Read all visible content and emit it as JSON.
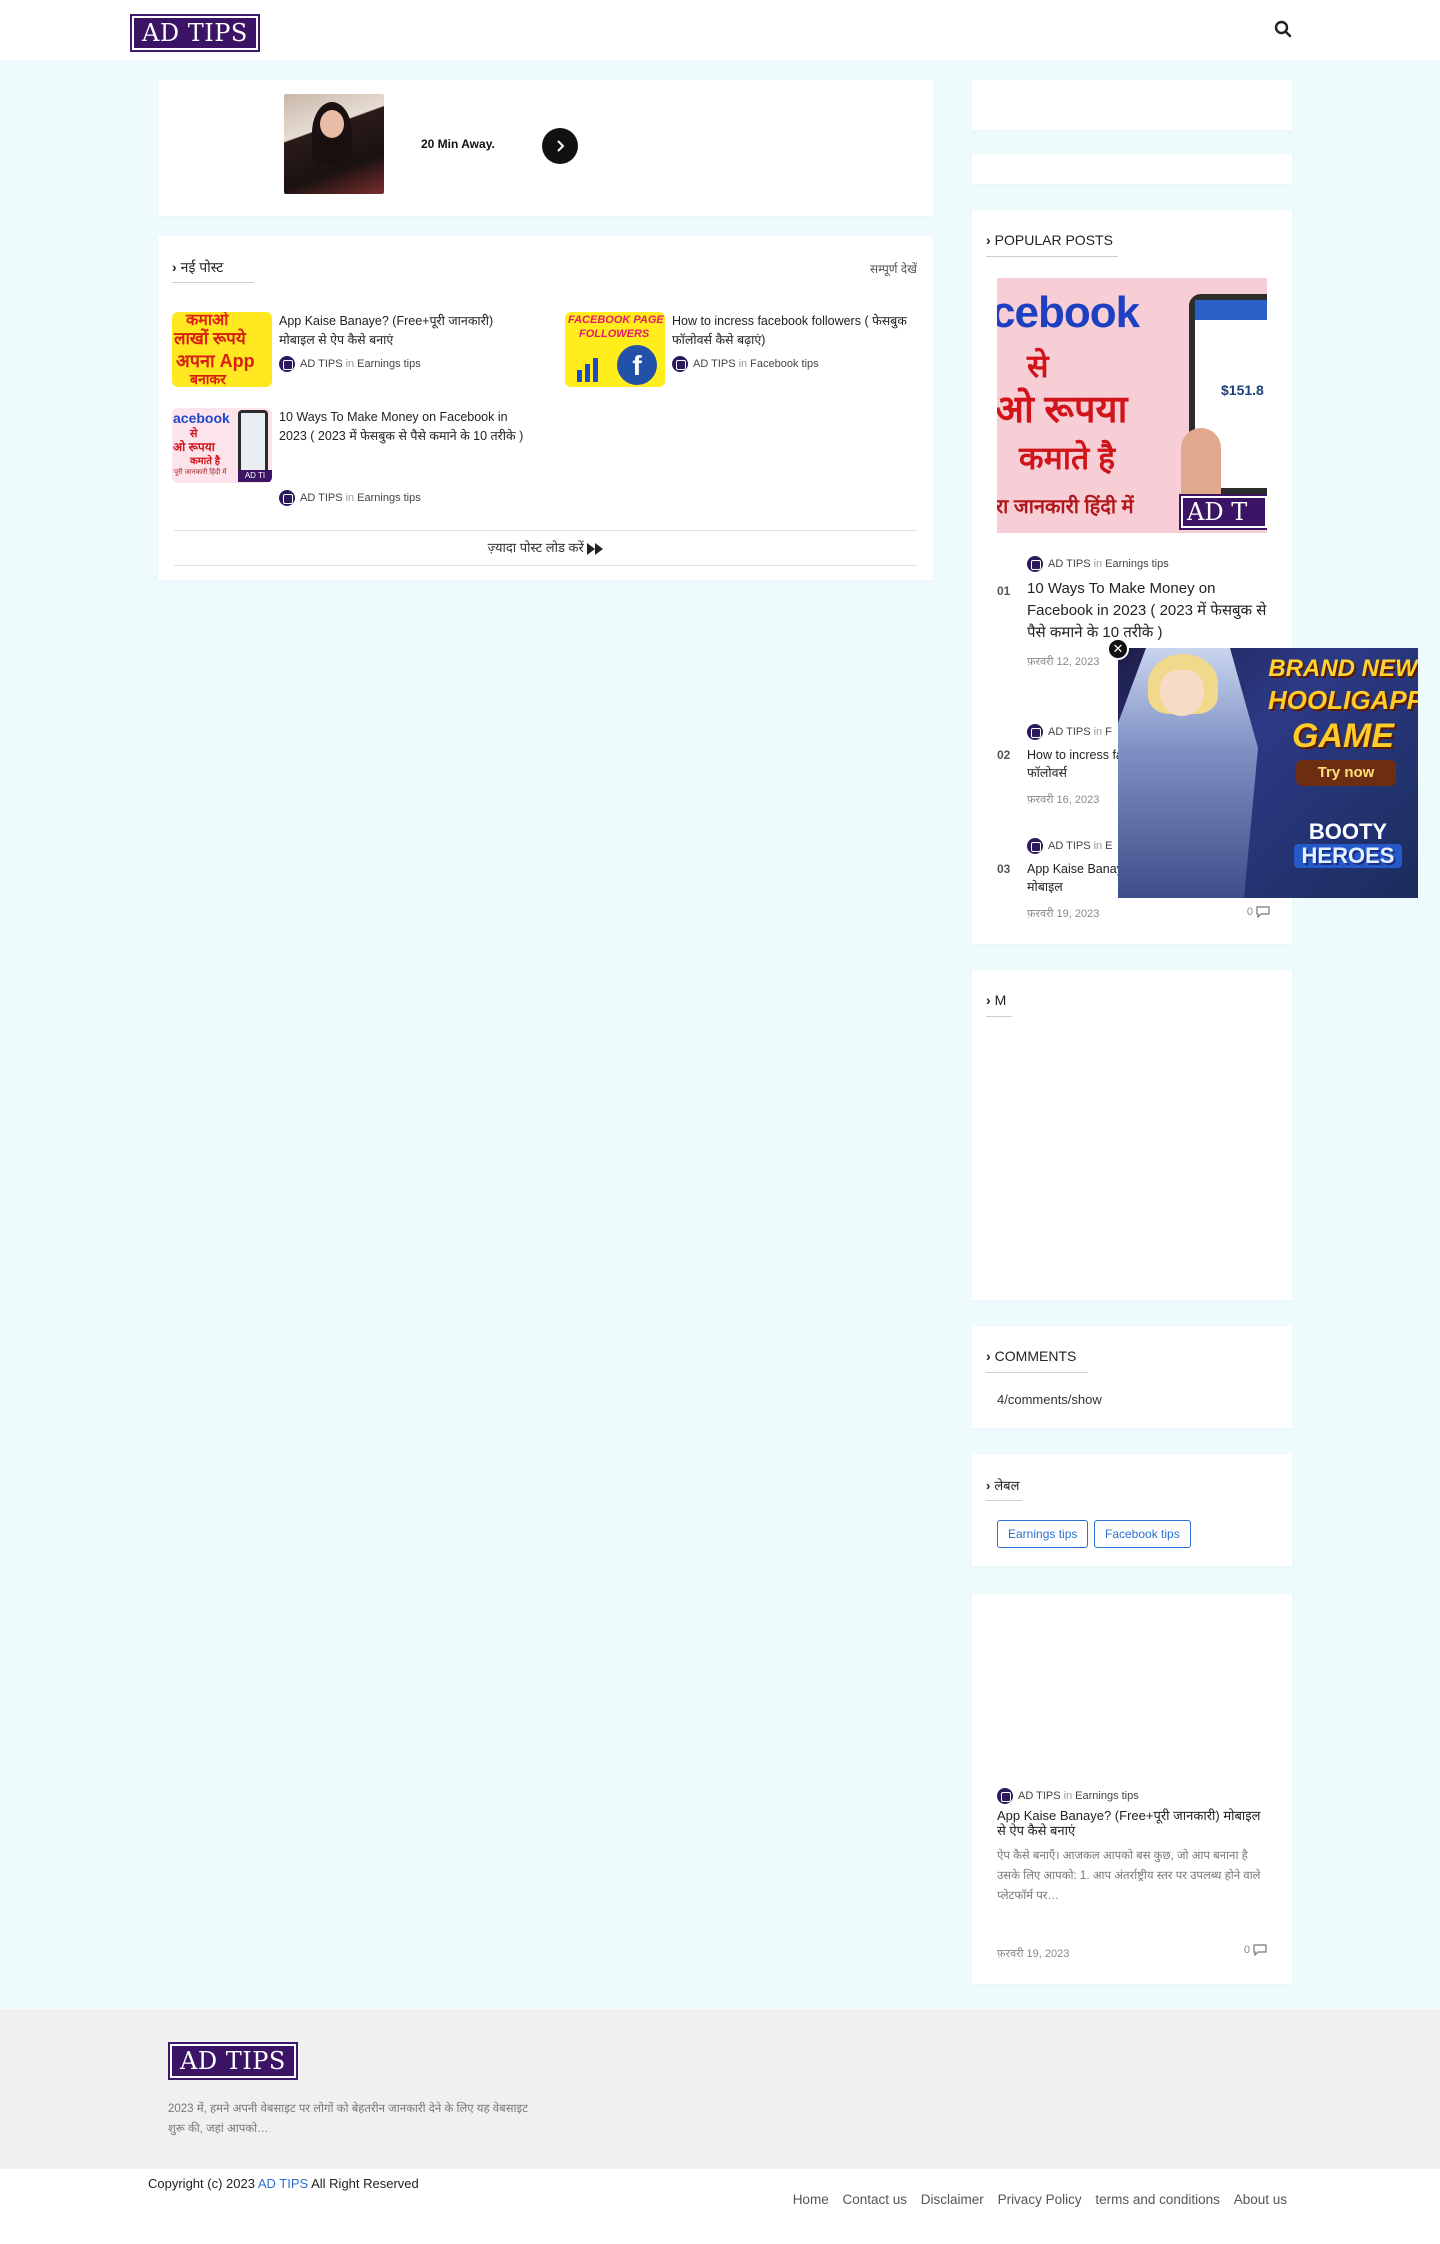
{
  "header": {
    "logo_text": "AD TIPS"
  },
  "ad": {
    "text": "20 Min Away."
  },
  "recent": {
    "title": "नई पोस्ट",
    "view_all": "सम्पूर्ण देखें",
    "load_more": "ज़्यादा पोस्ट लोड करें",
    "posts": [
      {
        "title": "App Kaise Banaye? (Free+पूरी जानकारी) मोबाइल से ऐप कैसे बनाएं",
        "author": "AD TIPS",
        "in": "in",
        "category": "Earnings tips"
      },
      {
        "title": "How to incress facebook followers ( फेसबुक फॉलोवर्स कैसे बढ़ाएं)",
        "author": "AD TIPS",
        "in": "in",
        "category": "Facebook tips"
      },
      {
        "title": "10 Ways To Make Money on Facebook in 2023 ( 2023 में फेसबुक से पैसे कमाने के 10 तरीके )",
        "author": "AD TIPS",
        "in": "in",
        "category": "Earnings tips"
      }
    ],
    "thumbs": {
      "yellow": [
        "कमाओ",
        "लाखों रूपये",
        "अपना App",
        "बनाकर"
      ],
      "fb": [
        "FACEBOOK PAGE",
        "FOLLOWERS",
        "f"
      ],
      "money": [
        "acebook",
        "से",
        "ओ रूपया",
        "कमाते है",
        "पूरी जानकारी हिंदी में",
        "AD TI"
      ]
    }
  },
  "popular": {
    "title": "POPULAR POSTS",
    "hero": [
      "cebook",
      "से",
      "ओ रूपया",
      "कमाते है",
      "रा जानकारी हिंदी में",
      "$151.8",
      "AD T"
    ],
    "items": [
      {
        "num": "01",
        "author": "AD TIPS",
        "in": "in",
        "category": "Earnings tips",
        "title": "10 Ways To Make Money on Facebook in 2023 ( 2023 में फेसबुक से पैसे कमाने के 10 तरीके )",
        "date": "फ़रवरी 12, 2023"
      },
      {
        "num": "02",
        "author": "AD TIPS",
        "in": "in",
        "category": "F",
        "title": "How to incress facebook followers ( फेसबुक फॉलोवर्स",
        "date": "फ़रवरी 16, 2023"
      },
      {
        "num": "03",
        "author": "AD TIPS",
        "in": "in",
        "category": "E",
        "title": "App Kaise Banaye? (Free+पूरी जानकारी) मोबाइल",
        "date": "फ़रवरी 19, 2023",
        "comments": "0"
      }
    ]
  },
  "m_widget": {
    "title": "M"
  },
  "comments_widget": {
    "title": "COMMENTS",
    "text": "4/comments/show"
  },
  "labels_widget": {
    "title": "लेबल",
    "tags": [
      "Earnings tips",
      "Facebook tips"
    ]
  },
  "featured": {
    "author": "AD TIPS",
    "in": "in",
    "category": "Earnings tips",
    "title": "App Kaise Banaye? (Free+पूरी जानकारी) मोबाइल से ऐप कैसे बनाएं",
    "snippet": "ऐप कैसे बनाएँ। आजकल आपको बस कुछ, जो आप बनाना है उसके लिए आपको: 1. आप अंतर्राष्ट्रीय स्तर पर उपलब्ध होने वाले प्लेटफॉर्म पर…",
    "date": "फ़रवरी 19, 2023",
    "comments": "0"
  },
  "game_ad": {
    "line1": "BRAND NEW",
    "line2": "HOOLIGAPPS",
    "line3": "GAME",
    "cta": "Try now",
    "line4": "BOOTY",
    "line5": "HEROES"
  },
  "footer": {
    "logo_text": "AD TIPS",
    "about": "2023 में, हमने अपनी वेबसाइट पर लोगों को बेहतरीन जानकारी देने के लिए यह वेबसाइट शुरू की, जहां आपको…",
    "copyright_prefix": "Copyright (c) 2023",
    "site": "AD TIPS",
    "copyright_suffix": "All Right Reserved",
    "links": [
      "Home",
      "Contact us",
      "Disclaimer",
      "Privacy Policy",
      "terms and conditions",
      "About us"
    ]
  },
  "colors": {
    "brand": "#3b1466",
    "page_bg": "#eefbfd",
    "link": "#2a6fd1"
  }
}
